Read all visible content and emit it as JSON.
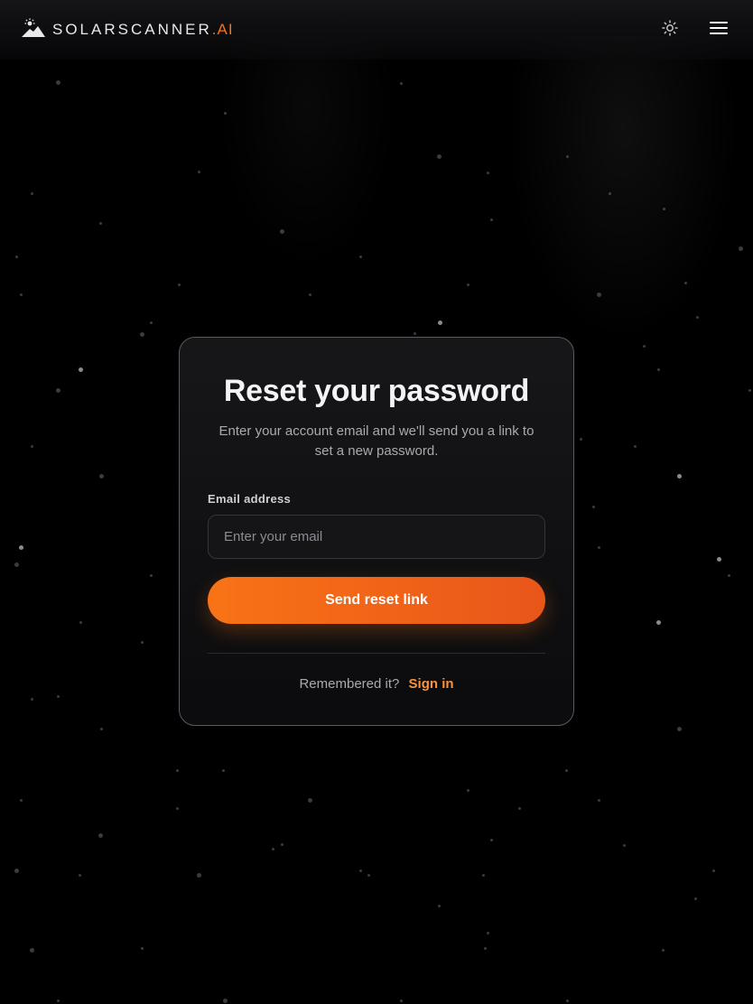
{
  "header": {
    "brand_name": "SOLARSCANNER",
    "brand_suffix": ".AI",
    "icons": {
      "logo": "sunrise-mountain-logo",
      "theme_toggle": "sun-icon",
      "menu": "hamburger-menu-icon"
    }
  },
  "form": {
    "title": "Reset your password",
    "subtitle": "Enter your account email and we'll send you a link to set a new password.",
    "email_label": "Email address",
    "email_placeholder": "Enter your email",
    "email_value": "",
    "submit_label": "Send reset link",
    "footer_prompt": "Remembered it?",
    "footer_link": "Sign in"
  },
  "colors": {
    "accent": "#f97316",
    "accent_dark": "#e8561a",
    "link": "#fb923c",
    "background": "#000000",
    "card_border": "#5a5a60"
  }
}
